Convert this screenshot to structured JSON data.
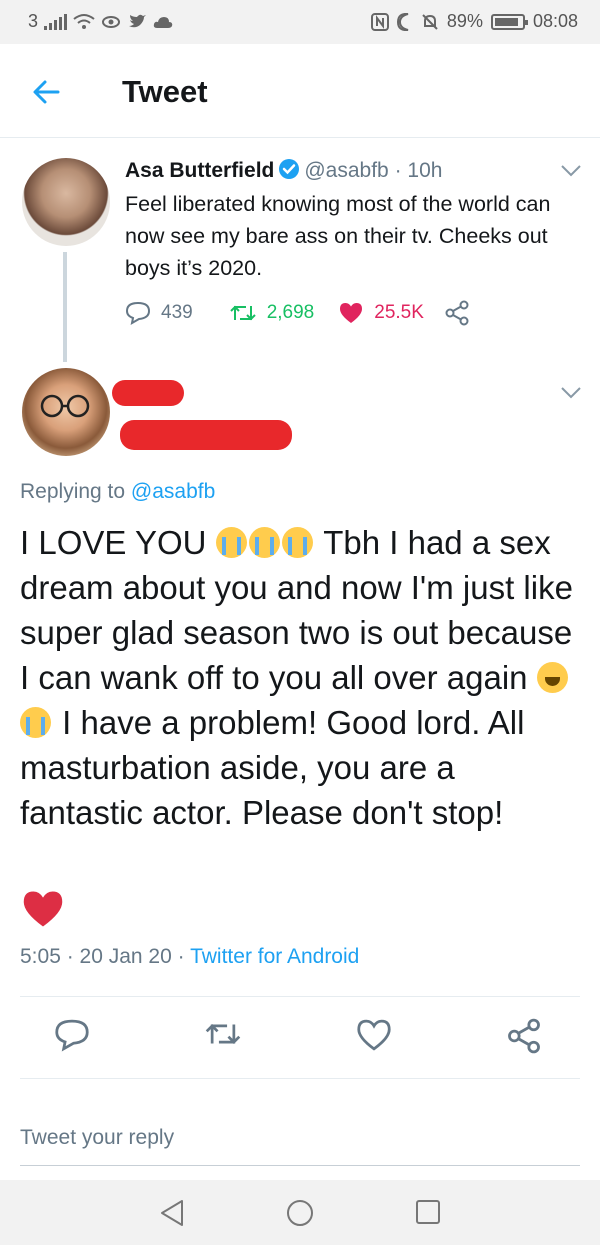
{
  "status_bar": {
    "carrier": "3",
    "battery_percent": "89%",
    "battery_level": 0.89,
    "time": "08:08"
  },
  "header": {
    "title": "Tweet",
    "back_icon": "arrow-left-icon"
  },
  "original_tweet": {
    "author_name": "Asa Butterfield",
    "author_handle": "@asabfb",
    "time_ago": "· 10h",
    "text": "Feel liberated knowing most of the world can now see my bare ass on their tv. Cheeks out boys it’s 2020.",
    "replies": "439",
    "retweets": "2,698",
    "likes": "25.5K"
  },
  "reply_tweet": {
    "replying_to_label": "Replying to",
    "replying_to_handle": "@asabfb",
    "text_part1": "I LOVE YOU",
    "text_part2": "Tbh I had a sex dream about you and now I'm just like super glad season two is out because I can wank off to you all over again",
    "text_part3": "I have a problem! Good lord. All masturbation aside, you are a fantastic actor. Please don't stop!",
    "time": "5:05",
    "date": "· 20 Jan 20 ·",
    "source": "Twitter for Android"
  },
  "composer": {
    "placeholder": "Tweet your reply"
  },
  "colors": {
    "accent": "#1da1f2",
    "retweet": "#17bf63",
    "like": "#e0245e",
    "muted": "#657786",
    "redaction": "#e8282b"
  }
}
